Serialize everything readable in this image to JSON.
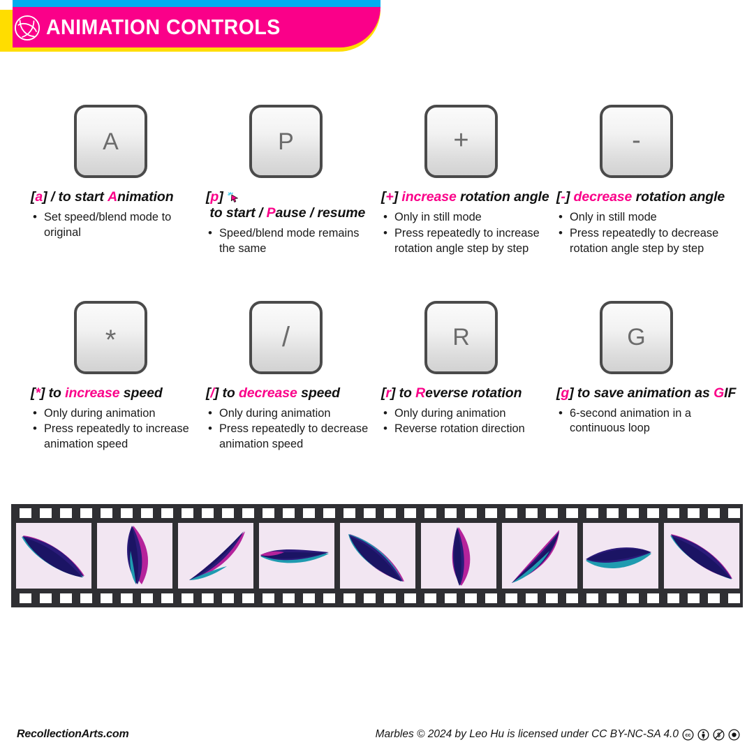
{
  "header": {
    "title": "ANIMATION CONTROLS",
    "logo_icon": "leaf-circle-logo",
    "colors": {
      "cyan": "#00AEEF",
      "yellow": "#FFDD00",
      "pink": "#FA0089"
    }
  },
  "keys": [
    {
      "key_label": "A",
      "key_name": "key-a",
      "heading_parts": [
        {
          "text": "[",
          "color": "black"
        },
        {
          "text": "a",
          "color": "pink"
        },
        {
          "text": "] / to start ",
          "color": "black"
        },
        {
          "text": "A",
          "color": "pink"
        },
        {
          "text": "nimation",
          "color": "black"
        }
      ],
      "heading_plain": "[a] / to start Animation",
      "icon": null,
      "bullets": [
        "Set speed/blend mode to original"
      ]
    },
    {
      "key_label": "P",
      "key_name": "key-p",
      "heading_parts": [
        {
          "text": "[",
          "color": "black"
        },
        {
          "text": "p",
          "color": "pink"
        },
        {
          "text": "] ",
          "color": "black"
        },
        {
          "text": "ICON",
          "color": "icon"
        },
        {
          "text": " to start / ",
          "color": "black"
        },
        {
          "text": "P",
          "color": "pink"
        },
        {
          "text": "ause / resume",
          "color": "black"
        }
      ],
      "heading_plain": "[p] to start / Pause / resume",
      "icon": "mouse-cursor-click-icon",
      "bullets": [
        "Speed/blend mode remains the same"
      ]
    },
    {
      "key_label": "+",
      "key_name": "key-plus",
      "heading_parts": [
        {
          "text": "[",
          "color": "black"
        },
        {
          "text": "+",
          "color": "pink"
        },
        {
          "text": "] ",
          "color": "black"
        },
        {
          "text": "increase",
          "color": "pink"
        },
        {
          "text": " rotation angle",
          "color": "black"
        }
      ],
      "heading_plain": "[+] increase rotation angle",
      "icon": null,
      "bullets": [
        "Only in still mode",
        "Press repeatedly to increase rotation angle step by step"
      ]
    },
    {
      "key_label": "-",
      "key_name": "key-minus",
      "heading_parts": [
        {
          "text": "[",
          "color": "black"
        },
        {
          "text": "-",
          "color": "pink"
        },
        {
          "text": "] ",
          "color": "black"
        },
        {
          "text": "decrease",
          "color": "pink"
        },
        {
          "text": " rotation angle",
          "color": "black"
        }
      ],
      "heading_plain": "[-] decrease rotation angle",
      "icon": null,
      "bullets": [
        "Only in still mode",
        "Press repeatedly to decrease rotation angle step by step"
      ]
    },
    {
      "key_label": "*",
      "key_name": "key-asterisk",
      "heading_parts": [
        {
          "text": "[",
          "color": "black"
        },
        {
          "text": "*",
          "color": "pink"
        },
        {
          "text": "] to ",
          "color": "black"
        },
        {
          "text": "increase",
          "color": "pink"
        },
        {
          "text": " speed",
          "color": "black"
        }
      ],
      "heading_plain": "[*] to increase speed",
      "icon": null,
      "bullets": [
        "Only during animation",
        "Press repeatedly to increase animation speed"
      ]
    },
    {
      "key_label": "/",
      "key_name": "key-slash",
      "heading_parts": [
        {
          "text": "[",
          "color": "black"
        },
        {
          "text": "/",
          "color": "pink"
        },
        {
          "text": "] to ",
          "color": "black"
        },
        {
          "text": "decrease",
          "color": "pink"
        },
        {
          "text": " speed",
          "color": "black"
        }
      ],
      "heading_plain": "[/] to decrease speed",
      "icon": null,
      "bullets": [
        "Only during animation",
        "Press repeatedly to decrease animation speed"
      ]
    },
    {
      "key_label": "R",
      "key_name": "key-r",
      "heading_parts": [
        {
          "text": "[",
          "color": "black"
        },
        {
          "text": "r",
          "color": "pink"
        },
        {
          "text": "] to ",
          "color": "black"
        },
        {
          "text": "R",
          "color": "pink"
        },
        {
          "text": "everse rotation",
          "color": "black"
        }
      ],
      "heading_plain": "[r] to Reverse rotation",
      "icon": null,
      "bullets": [
        "Only during animation",
        "Reverse rotation direction"
      ]
    },
    {
      "key_label": "G",
      "key_name": "key-g",
      "heading_parts": [
        {
          "text": "[",
          "color": "black"
        },
        {
          "text": "g",
          "color": "pink"
        },
        {
          "text": "] to save animation as ",
          "color": "black"
        },
        {
          "text": "G",
          "color": "pink"
        },
        {
          "text": "IF",
          "color": "black"
        }
      ],
      "heading_plain": "[g] to save animation as GIF",
      "icon": null,
      "bullets": [
        "6-second animation in a continuous loop"
      ]
    }
  ],
  "filmstrip": {
    "frame_count": 9,
    "frame_background": "#f2e6f2",
    "strip_color": "#2f2f33",
    "marble_colors": {
      "navy": "#2b1b7a",
      "indigo": "#3a2a8f",
      "magenta": "#b5239b",
      "teal": "#1f9bb0",
      "deep_navy": "#1b1464"
    },
    "frames": [
      {
        "name": "frame-1",
        "pose": "diagonal-leaf-down-right"
      },
      {
        "name": "frame-2",
        "pose": "vertical-flame"
      },
      {
        "name": "frame-3",
        "pose": "diagonal-leaf-up-right"
      },
      {
        "name": "frame-4",
        "pose": "flat-horizontal-wave"
      },
      {
        "name": "frame-5",
        "pose": "diagonal-leaf-down-left"
      },
      {
        "name": "frame-6",
        "pose": "vertical-narrow-flame"
      },
      {
        "name": "frame-7",
        "pose": "steep-diagonal-up"
      },
      {
        "name": "frame-8",
        "pose": "low-horizontal-leaf"
      },
      {
        "name": "frame-9",
        "pose": "wide-diagonal-leaf"
      }
    ]
  },
  "footer": {
    "site": "RecollectionArts.com",
    "license": "Marbles © 2024 by Leo Hu is licensed under CC BY-NC-SA 4.0",
    "badges": [
      "cc-icon",
      "by-icon",
      "nc-icon",
      "sa-icon"
    ]
  }
}
